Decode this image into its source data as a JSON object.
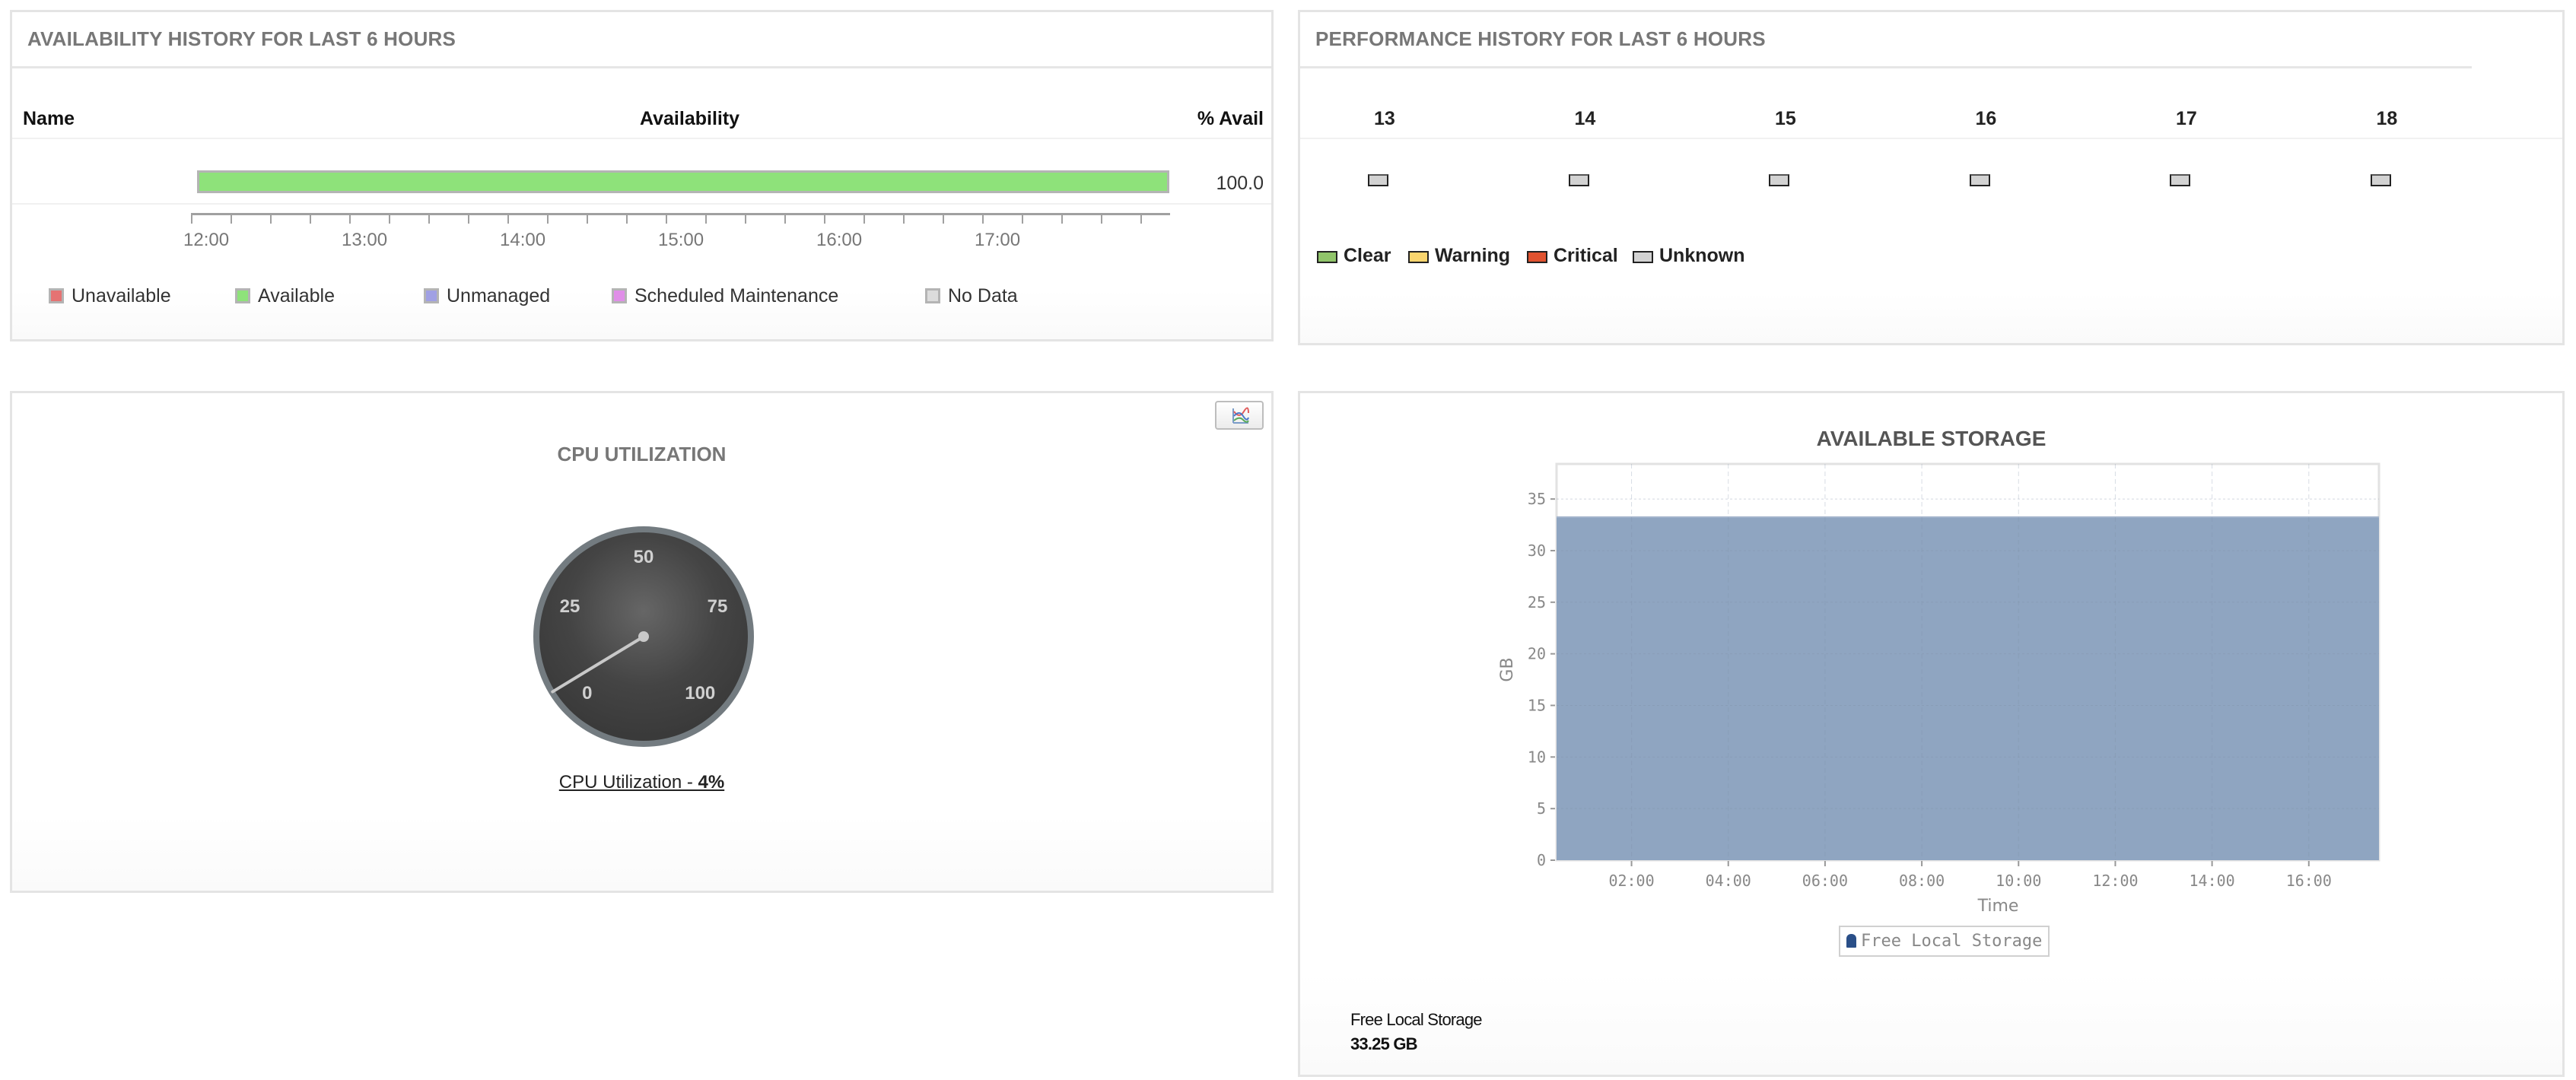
{
  "availability": {
    "title": "AVAILABILITY HISTORY FOR LAST 6 HOURS",
    "columns": {
      "name": "Name",
      "availability": "Availability",
      "pct": "% Avail"
    },
    "rows": [
      {
        "name": "",
        "status": "Available",
        "pct_avail": "100.0"
      }
    ],
    "axis_labels": [
      "12:00",
      "13:00",
      "14:00",
      "15:00",
      "16:00",
      "17:00"
    ],
    "legend": [
      {
        "label": "Unavailable",
        "color": "#e57373"
      },
      {
        "label": "Available",
        "color": "#8ee27a"
      },
      {
        "label": "Unmanaged",
        "color": "#a0a0e4"
      },
      {
        "label": "Scheduled Maintenance",
        "color": "#e08ee8"
      },
      {
        "label": "No Data",
        "color": "#dcdcdc"
      }
    ]
  },
  "performance": {
    "title": "PERFORMANCE HISTORY FOR LAST 6 HOURS",
    "hours": [
      {
        "label": "13",
        "status": "Unknown"
      },
      {
        "label": "14",
        "status": "Unknown"
      },
      {
        "label": "15",
        "status": "Unknown"
      },
      {
        "label": "16",
        "status": "Unknown"
      },
      {
        "label": "17",
        "status": "Unknown"
      },
      {
        "label": "18",
        "status": "Unknown"
      }
    ],
    "legend": [
      {
        "label": "Clear",
        "color": "#90c46a"
      },
      {
        "label": "Warning",
        "color": "#f9d56e"
      },
      {
        "label": "Critical",
        "color": "#e0522f"
      },
      {
        "label": "Unknown",
        "color": "#d2d2d2"
      }
    ]
  },
  "cpu": {
    "title": "CPU UTILIZATION",
    "chart_button_icon": "line-chart-icon",
    "gauge": {
      "min": 0,
      "max": 100,
      "value": 4,
      "labels": [
        "0",
        "25",
        "50",
        "75",
        "100"
      ]
    },
    "link_prefix": "CPU Utilization - ",
    "link_value": "4%"
  },
  "storage": {
    "footer_label": "Free Local Storage",
    "footer_value": "33.25 GB"
  },
  "chart_data": {
    "type": "area",
    "title": "AVAILABLE STORAGE",
    "xlabel": "Time",
    "ylabel": "GB",
    "x_ticks": [
      "02:00",
      "04:00",
      "06:00",
      "08:00",
      "10:00",
      "12:00",
      "14:00",
      "16:00"
    ],
    "x_tick_hours": [
      2,
      4,
      6,
      8,
      10,
      12,
      14,
      16
    ],
    "xlim_hours": [
      0.45,
      17.45
    ],
    "y_ticks": [
      0,
      5,
      10,
      15,
      20,
      25,
      30,
      35
    ],
    "ylim": [
      0,
      38.4
    ],
    "grid": true,
    "legend": {
      "position": "bottom-center",
      "entries": [
        "Free Local Storage"
      ]
    },
    "series": [
      {
        "name": "Free Local Storage",
        "color": "#8fa5c1",
        "marker_color": "#2a4f88",
        "x_hours": [
          0.45,
          17.45
        ],
        "values": [
          33.25,
          33.25
        ]
      }
    ]
  }
}
